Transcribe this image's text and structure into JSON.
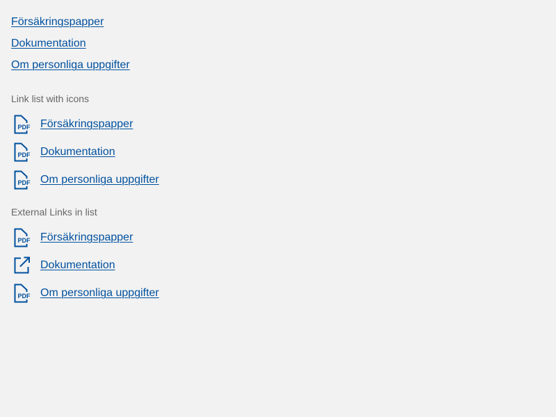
{
  "plain_links": [
    {
      "label": "Försäkringspapper"
    },
    {
      "label": "Dokumentation"
    },
    {
      "label": "Om personliga uppgifter"
    }
  ],
  "icon_section": {
    "heading": "Link list with icons",
    "items": [
      {
        "label": "Försäkringspapper",
        "icon": "pdf-icon"
      },
      {
        "label": "Dokumentation",
        "icon": "pdf-icon"
      },
      {
        "label": "Om personliga uppgifter",
        "icon": "pdf-icon"
      }
    ]
  },
  "external_section": {
    "heading": "External Links in list",
    "items": [
      {
        "label": "Försäkringspapper",
        "icon": "pdf-icon"
      },
      {
        "label": "Dokumentation",
        "icon": "external-link-icon"
      },
      {
        "label": "Om personliga uppgifter",
        "icon": "pdf-icon"
      }
    ]
  },
  "icon_text": "PDF",
  "colors": {
    "link": "#00509e",
    "label": "#666666",
    "background": "#f2f2f2"
  }
}
